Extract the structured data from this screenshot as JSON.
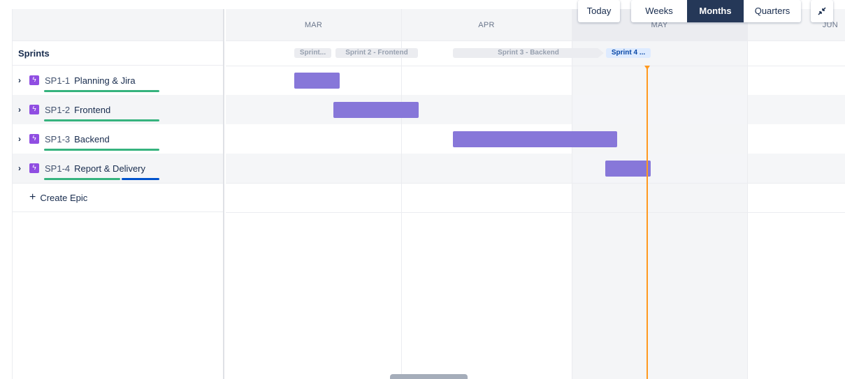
{
  "timeline": {
    "months": [
      "MAR",
      "APR",
      "MAY",
      "JUN"
    ],
    "current_month": "MAY"
  },
  "sprints_label": "Sprints",
  "sprints": [
    {
      "label": "Sprint...",
      "state": "closed"
    },
    {
      "label": "Sprint 2 - Frontend",
      "state": "closed"
    },
    {
      "label": "Sprint 3 - Backend",
      "state": "closed"
    },
    {
      "label": "Sprint 4 ...",
      "state": "active"
    }
  ],
  "epics": [
    {
      "key": "SP1-1",
      "name": "Planning & Jira",
      "icon": "lightning-icon",
      "progress_done": 1.0,
      "progress_in_progress": 0.0
    },
    {
      "key": "SP1-2",
      "name": "Frontend",
      "icon": "lightning-icon",
      "progress_done": 1.0,
      "progress_in_progress": 0.0
    },
    {
      "key": "SP1-3",
      "name": "Backend",
      "icon": "lightning-icon",
      "progress_done": 1.0,
      "progress_in_progress": 0.0
    },
    {
      "key": "SP1-4",
      "name": "Report & Delivery",
      "icon": "lightning-icon",
      "progress_done": 0.66,
      "progress_in_progress": 0.34
    }
  ],
  "create_epic_label": "Create Epic",
  "controls": {
    "today": "Today",
    "views": [
      "Weeks",
      "Months",
      "Quarters"
    ],
    "selected_view": "Months",
    "collapse_icon": "collapse-arrows-icon"
  },
  "colors": {
    "epic_bar": "#8777d9",
    "today_marker": "#ff991f",
    "progress_done": "#36b37e",
    "progress_in_progress": "#0052cc",
    "epic_icon": "#904ee2"
  }
}
